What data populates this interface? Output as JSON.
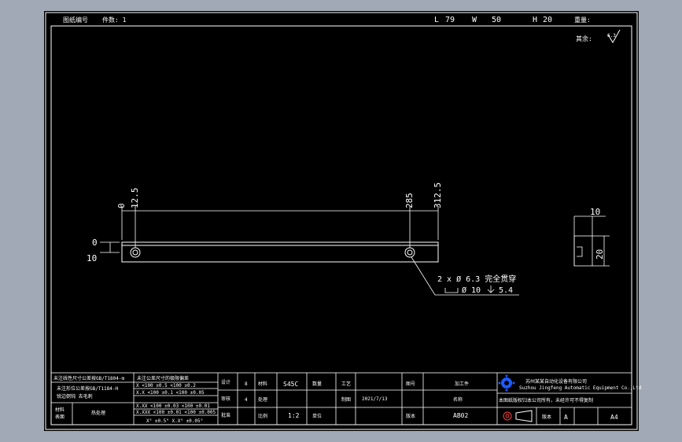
{
  "header": {
    "field_a": "图纸编号",
    "field_b": "件数: 1",
    "L_label": "L",
    "L_value": "79",
    "W_label": "W",
    "W_value": "50",
    "H_label": "H",
    "H_value": "20",
    "weight_label": "重量:"
  },
  "roughness": {
    "label": "其余:",
    "value": "6.3"
  },
  "dimensions": {
    "top_0": "0",
    "top_12_5": "12.5",
    "top_285": "285",
    "top_312_5": "312.5",
    "left_0": "0",
    "left_10": "10",
    "side_10": "10",
    "side_20": "20"
  },
  "callout": {
    "line1": "2 x Ø 6.3 完全贯穿",
    "line2_a": "Ø 10",
    "line2_b": "5.4"
  },
  "title_block": {
    "notes": [
      "未注线性尺寸公差按GB/T1804-m",
      "未注形位公差按GB/T1184-H",
      "锐边倒钝 去毛刺"
    ],
    "tol_header": "未注公差尺寸的极限偏差",
    "tol_rows": [
      "X   <100 ±0.5  <100 ±0.2",
      "X.X  <100 ±0.1  <100 ±0.05",
      "X.XX <100 ±0.03 <100 ±0.01",
      "X.XXX <100 ±0.01 <100 ±0.005",
      "X°  ±0.5°    X.X° ±0.05°"
    ],
    "left_label_1": "材料",
    "left_label_2": "表面",
    "left_label_3": "热处理",
    "c1": [
      "设计",
      "审核",
      "批准"
    ],
    "c2": [
      "8",
      "4",
      ""
    ],
    "c3": [
      "材料",
      "处理",
      "比例"
    ],
    "material": "S45C",
    "scale": "1:2",
    "c5": [
      "数量",
      "",
      "单位"
    ],
    "c6": [
      "工艺",
      "制图",
      ""
    ],
    "date": "2021/7/13",
    "c8": [
      "图号",
      "",
      "版本"
    ],
    "name_label": "名称",
    "name_value": "加工件",
    "drawing_no": "AB02",
    "company_name": "苏州某某自动化设备有限公司",
    "company_en": "Suzhou Jingfeng Automatic Equipment Co.,Ltd",
    "legal_text": "本图纸版权归本公司所有，未经许可不得复制",
    "sheet_label": "版本",
    "rev": "A",
    "size": "A4"
  },
  "colors": {
    "background": "#a0a9b5",
    "canvas": "#000000",
    "line": "#ffffff",
    "logo": "#1e5aff"
  }
}
